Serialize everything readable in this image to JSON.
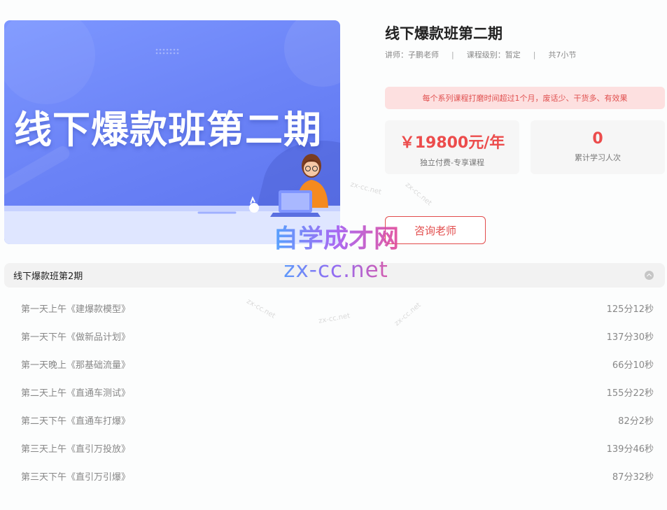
{
  "course": {
    "banner_text": "线下爆款班第二期",
    "title": "线下爆款班第二期",
    "teacher": "讲师：子鹏老师",
    "level": "课程级别：暂定",
    "sections": "共7小节",
    "separator": "|",
    "notice": "每个系列课程打磨时间超过1个月，废话少、干货多、有效果"
  },
  "stats": {
    "price_value": "￥19800元/年",
    "price_label": "独立付费-专享课程",
    "learners_value": "0",
    "learners_label": "累计学习人次"
  },
  "consult_button": "咨询老师",
  "chapter": {
    "name": "线下爆款班第2期",
    "lessons": [
      {
        "title": "第一天上午《建爆款模型》",
        "duration": "125分12秒"
      },
      {
        "title": "第一天下午《做新品计划》",
        "duration": "137分30秒"
      },
      {
        "title": "第一天晚上《那基础流量》",
        "duration": "66分10秒"
      },
      {
        "title": "第二天上午《直通车测试》",
        "duration": "155分22秒"
      },
      {
        "title": "第二天下午《直通车打爆》",
        "duration": "82分2秒"
      },
      {
        "title": "第三天上午《直引万投放》",
        "duration": "139分46秒"
      },
      {
        "title": "第三天下午《直引万引爆》",
        "duration": "87分32秒"
      }
    ]
  },
  "watermark": {
    "cn": "自学成才网",
    "en": "zx-cc.net",
    "small": "zx-cc.net"
  },
  "colors": {
    "accent_red": "#e24c4c",
    "banner_blue": "#6c84f7"
  }
}
